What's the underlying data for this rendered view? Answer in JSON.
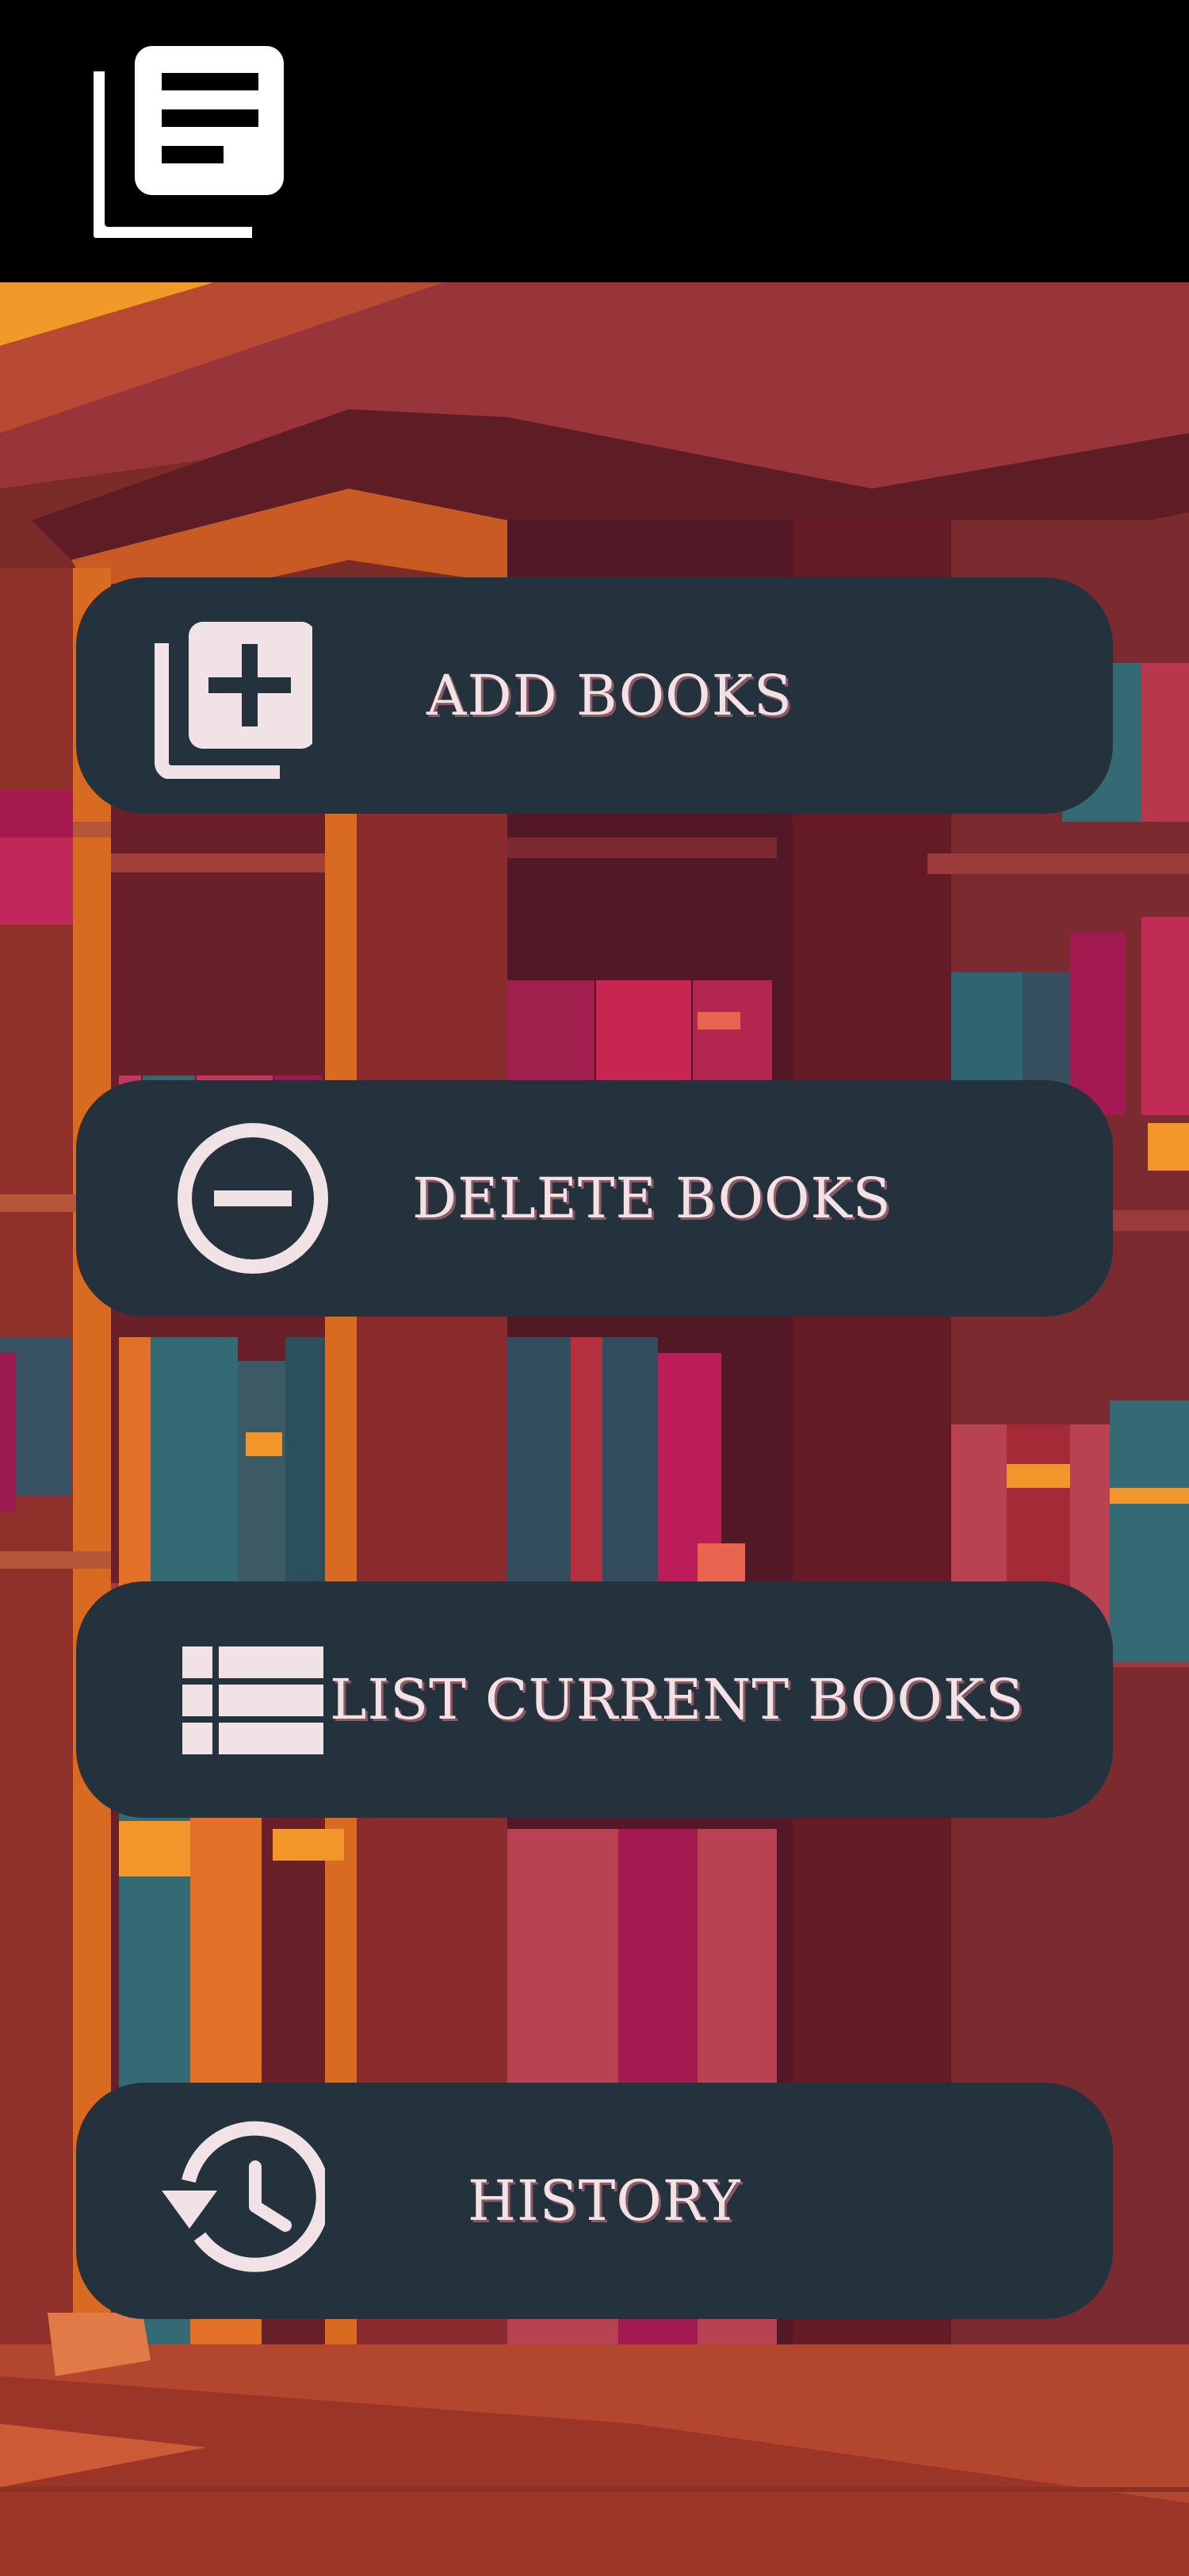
{
  "app_bar": {
    "logo_icon": "library-books-icon",
    "background": "#000000"
  },
  "menu": {
    "items": [
      {
        "id": "add",
        "label": "ADD BOOKS",
        "icon": "library-add-icon"
      },
      {
        "id": "delete",
        "label": "DELETE BOOKS",
        "icon": "remove-circle-outline-icon"
      },
      {
        "id": "list",
        "label": "LIST CURRENT BOOKS",
        "icon": "view-list-icon"
      },
      {
        "id": "history",
        "label": "HISTORY",
        "icon": "history-icon"
      }
    ],
    "button_color": "#24323d",
    "label_color": "#f1e3e5"
  },
  "background": {
    "illustration": "library-bookshelves"
  }
}
